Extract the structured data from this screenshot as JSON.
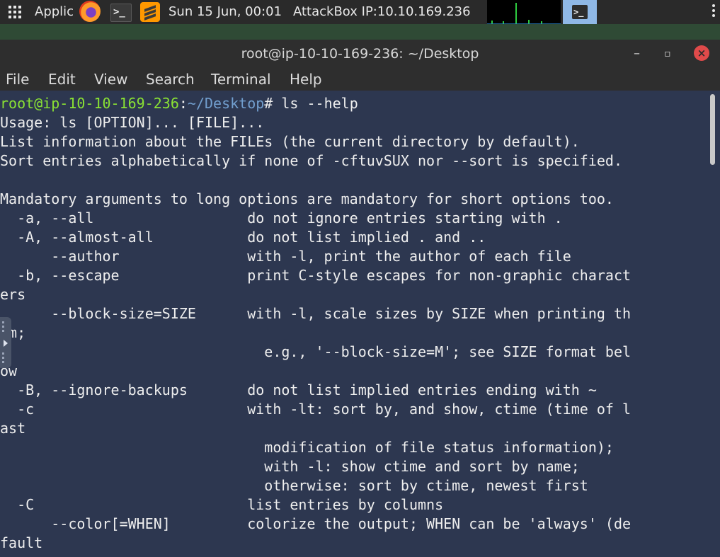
{
  "panel": {
    "apps_label": "Applic",
    "clock": "Sun 15 Jun, 00:01",
    "attackbox_ip": "AttackBox IP:10.10.169.236"
  },
  "window": {
    "title": "root@ip-10-10-169-236: ~/Desktop",
    "minimize": "–",
    "maximize": "▫",
    "close": "×"
  },
  "menu": [
    "File",
    "Edit",
    "View",
    "Search",
    "Terminal",
    "Help"
  ],
  "prompt": {
    "user_host": "root@ip-10-10-169-236",
    "sep": ":",
    "path": "~/Desktop",
    "symbol": "# ",
    "command": "ls --help"
  },
  "output_lines": [
    "Usage: ls [OPTION]... [FILE]...",
    "List information about the FILEs (the current directory by default).",
    "Sort entries alphabetically if none of -cftuvSUX nor --sort is specified.",
    "",
    "Mandatory arguments to long options are mandatory for short options too.",
    "  -a, --all                  do not ignore entries starting with .",
    "  -A, --almost-all           do not list implied . and ..",
    "      --author               with -l, print the author of each file",
    "  -b, --escape               print C-style escapes for non-graphic charact",
    "ers",
    "      --block-size=SIZE      with -l, scale sizes by SIZE when printing th",
    "em;",
    "                               e.g., '--block-size=M'; see SIZE format bel",
    "ow",
    "  -B, --ignore-backups       do not list implied entries ending with ~",
    "  -c                         with -lt: sort by, and show, ctime (time of l",
    "ast",
    "                               modification of file status information);",
    "                               with -l: show ctime and sort by name;",
    "                               otherwise: sort by ctime, newest first",
    "  -C                         list entries by columns",
    "      --color[=WHEN]         colorize the output; WHEN can be 'always' (de",
    "fault"
  ]
}
